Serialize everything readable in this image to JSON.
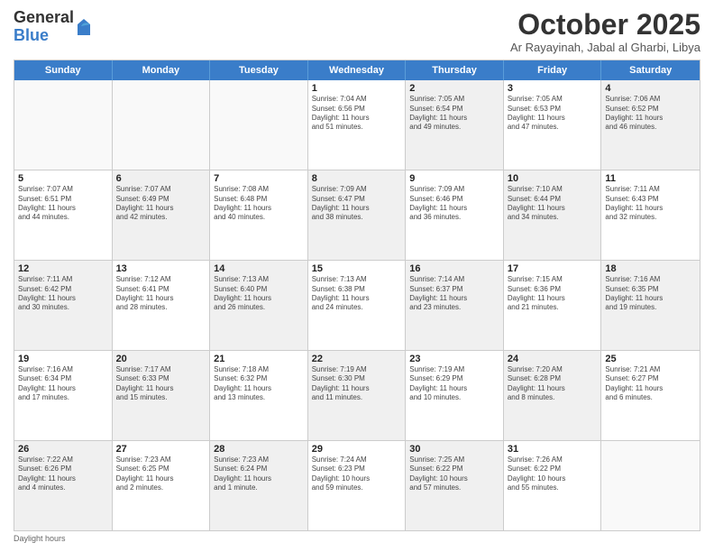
{
  "header": {
    "logo_general": "General",
    "logo_blue": "Blue",
    "month_title": "October 2025",
    "subtitle": "Ar Rayayinah, Jabal al Gharbi, Libya"
  },
  "days_of_week": [
    "Sunday",
    "Monday",
    "Tuesday",
    "Wednesday",
    "Thursday",
    "Friday",
    "Saturday"
  ],
  "footer": {
    "note": "Daylight hours"
  },
  "weeks": [
    {
      "cells": [
        {
          "day": "",
          "content": "",
          "empty": true
        },
        {
          "day": "",
          "content": "",
          "empty": true
        },
        {
          "day": "",
          "content": "",
          "empty": true
        },
        {
          "day": "1",
          "content": "Sunrise: 7:04 AM\nSunset: 6:56 PM\nDaylight: 11 hours\nand 51 minutes.",
          "empty": false,
          "shaded": false
        },
        {
          "day": "2",
          "content": "Sunrise: 7:05 AM\nSunset: 6:54 PM\nDaylight: 11 hours\nand 49 minutes.",
          "empty": false,
          "shaded": true
        },
        {
          "day": "3",
          "content": "Sunrise: 7:05 AM\nSunset: 6:53 PM\nDaylight: 11 hours\nand 47 minutes.",
          "empty": false,
          "shaded": false
        },
        {
          "day": "4",
          "content": "Sunrise: 7:06 AM\nSunset: 6:52 PM\nDaylight: 11 hours\nand 46 minutes.",
          "empty": false,
          "shaded": true
        }
      ]
    },
    {
      "cells": [
        {
          "day": "5",
          "content": "Sunrise: 7:07 AM\nSunset: 6:51 PM\nDaylight: 11 hours\nand 44 minutes.",
          "empty": false,
          "shaded": false
        },
        {
          "day": "6",
          "content": "Sunrise: 7:07 AM\nSunset: 6:49 PM\nDaylight: 11 hours\nand 42 minutes.",
          "empty": false,
          "shaded": true
        },
        {
          "day": "7",
          "content": "Sunrise: 7:08 AM\nSunset: 6:48 PM\nDaylight: 11 hours\nand 40 minutes.",
          "empty": false,
          "shaded": false
        },
        {
          "day": "8",
          "content": "Sunrise: 7:09 AM\nSunset: 6:47 PM\nDaylight: 11 hours\nand 38 minutes.",
          "empty": false,
          "shaded": true
        },
        {
          "day": "9",
          "content": "Sunrise: 7:09 AM\nSunset: 6:46 PM\nDaylight: 11 hours\nand 36 minutes.",
          "empty": false,
          "shaded": false
        },
        {
          "day": "10",
          "content": "Sunrise: 7:10 AM\nSunset: 6:44 PM\nDaylight: 11 hours\nand 34 minutes.",
          "empty": false,
          "shaded": true
        },
        {
          "day": "11",
          "content": "Sunrise: 7:11 AM\nSunset: 6:43 PM\nDaylight: 11 hours\nand 32 minutes.",
          "empty": false,
          "shaded": false
        }
      ]
    },
    {
      "cells": [
        {
          "day": "12",
          "content": "Sunrise: 7:11 AM\nSunset: 6:42 PM\nDaylight: 11 hours\nand 30 minutes.",
          "empty": false,
          "shaded": true
        },
        {
          "day": "13",
          "content": "Sunrise: 7:12 AM\nSunset: 6:41 PM\nDaylight: 11 hours\nand 28 minutes.",
          "empty": false,
          "shaded": false
        },
        {
          "day": "14",
          "content": "Sunrise: 7:13 AM\nSunset: 6:40 PM\nDaylight: 11 hours\nand 26 minutes.",
          "empty": false,
          "shaded": true
        },
        {
          "day": "15",
          "content": "Sunrise: 7:13 AM\nSunset: 6:38 PM\nDaylight: 11 hours\nand 24 minutes.",
          "empty": false,
          "shaded": false
        },
        {
          "day": "16",
          "content": "Sunrise: 7:14 AM\nSunset: 6:37 PM\nDaylight: 11 hours\nand 23 minutes.",
          "empty": false,
          "shaded": true
        },
        {
          "day": "17",
          "content": "Sunrise: 7:15 AM\nSunset: 6:36 PM\nDaylight: 11 hours\nand 21 minutes.",
          "empty": false,
          "shaded": false
        },
        {
          "day": "18",
          "content": "Sunrise: 7:16 AM\nSunset: 6:35 PM\nDaylight: 11 hours\nand 19 minutes.",
          "empty": false,
          "shaded": true
        }
      ]
    },
    {
      "cells": [
        {
          "day": "19",
          "content": "Sunrise: 7:16 AM\nSunset: 6:34 PM\nDaylight: 11 hours\nand 17 minutes.",
          "empty": false,
          "shaded": false
        },
        {
          "day": "20",
          "content": "Sunrise: 7:17 AM\nSunset: 6:33 PM\nDaylight: 11 hours\nand 15 minutes.",
          "empty": false,
          "shaded": true
        },
        {
          "day": "21",
          "content": "Sunrise: 7:18 AM\nSunset: 6:32 PM\nDaylight: 11 hours\nand 13 minutes.",
          "empty": false,
          "shaded": false
        },
        {
          "day": "22",
          "content": "Sunrise: 7:19 AM\nSunset: 6:30 PM\nDaylight: 11 hours\nand 11 minutes.",
          "empty": false,
          "shaded": true
        },
        {
          "day": "23",
          "content": "Sunrise: 7:19 AM\nSunset: 6:29 PM\nDaylight: 11 hours\nand 10 minutes.",
          "empty": false,
          "shaded": false
        },
        {
          "day": "24",
          "content": "Sunrise: 7:20 AM\nSunset: 6:28 PM\nDaylight: 11 hours\nand 8 minutes.",
          "empty": false,
          "shaded": true
        },
        {
          "day": "25",
          "content": "Sunrise: 7:21 AM\nSunset: 6:27 PM\nDaylight: 11 hours\nand 6 minutes.",
          "empty": false,
          "shaded": false
        }
      ]
    },
    {
      "cells": [
        {
          "day": "26",
          "content": "Sunrise: 7:22 AM\nSunset: 6:26 PM\nDaylight: 11 hours\nand 4 minutes.",
          "empty": false,
          "shaded": true
        },
        {
          "day": "27",
          "content": "Sunrise: 7:23 AM\nSunset: 6:25 PM\nDaylight: 11 hours\nand 2 minutes.",
          "empty": false,
          "shaded": false
        },
        {
          "day": "28",
          "content": "Sunrise: 7:23 AM\nSunset: 6:24 PM\nDaylight: 11 hours\nand 1 minute.",
          "empty": false,
          "shaded": true
        },
        {
          "day": "29",
          "content": "Sunrise: 7:24 AM\nSunset: 6:23 PM\nDaylight: 10 hours\nand 59 minutes.",
          "empty": false,
          "shaded": false
        },
        {
          "day": "30",
          "content": "Sunrise: 7:25 AM\nSunset: 6:22 PM\nDaylight: 10 hours\nand 57 minutes.",
          "empty": false,
          "shaded": true
        },
        {
          "day": "31",
          "content": "Sunrise: 7:26 AM\nSunset: 6:22 PM\nDaylight: 10 hours\nand 55 minutes.",
          "empty": false,
          "shaded": false
        },
        {
          "day": "",
          "content": "",
          "empty": true,
          "shaded": false
        }
      ]
    }
  ]
}
